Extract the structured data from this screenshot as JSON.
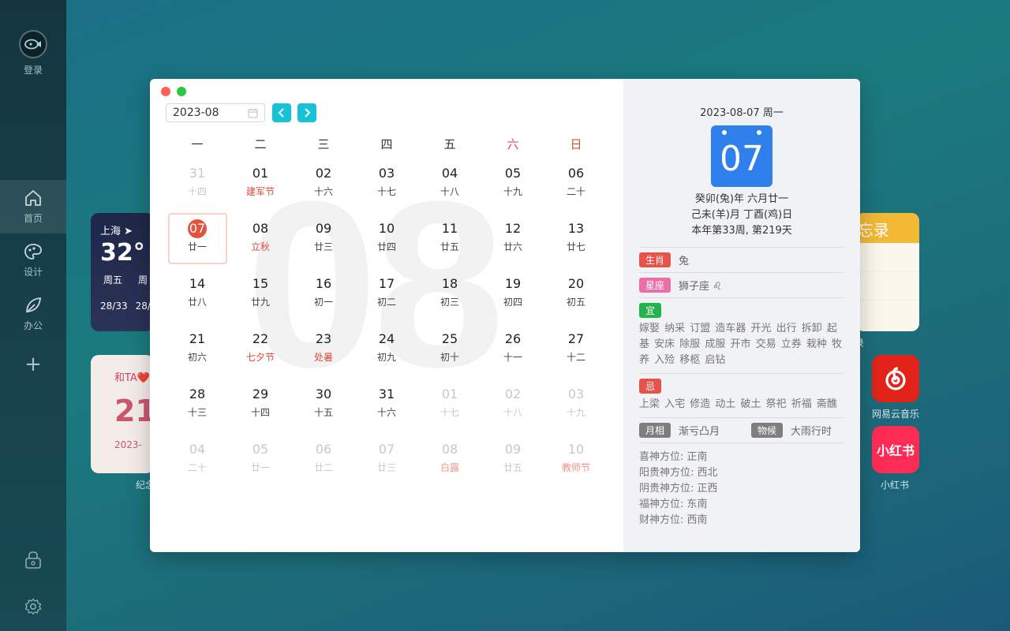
{
  "sidebar": {
    "login_label": "登录",
    "items": [
      {
        "label": "首页",
        "icon": "home-icon",
        "active": true
      },
      {
        "label": "设计",
        "icon": "palette-icon",
        "active": false
      },
      {
        "label": "办公",
        "icon": "leaf-icon",
        "active": false
      }
    ],
    "add_icon": "+"
  },
  "widgets": {
    "weather": {
      "city": "上海",
      "temp": "32°",
      "days": [
        "周五",
        "周"
      ],
      "temps": [
        "28/33",
        "28/"
      ]
    },
    "love": {
      "title": "和TA❤️",
      "number": "21",
      "date": "2023-",
      "label": "纪念"
    },
    "memo": {
      "title": "忘录",
      "label": "录"
    },
    "apps": [
      {
        "label": "网易云音乐",
        "color": "#e2231a"
      },
      {
        "label": "小红书",
        "glyph": "小红书",
        "color": "#fe2c55"
      }
    ]
  },
  "calendar": {
    "month_value": "2023-08",
    "big_month": "08",
    "weekdays": [
      "一",
      "二",
      "三",
      "四",
      "五",
      "六",
      "日"
    ],
    "weeks": [
      [
        {
          "d": "31",
          "l": "十四",
          "other": true
        },
        {
          "d": "01",
          "l": "建军节",
          "fest": true
        },
        {
          "d": "02",
          "l": "十六"
        },
        {
          "d": "03",
          "l": "十七"
        },
        {
          "d": "04",
          "l": "十八"
        },
        {
          "d": "05",
          "l": "十九"
        },
        {
          "d": "06",
          "l": "二十"
        }
      ],
      [
        {
          "d": "07",
          "l": "廿一",
          "sel": true
        },
        {
          "d": "08",
          "l": "立秋",
          "fest": true
        },
        {
          "d": "09",
          "l": "廿三"
        },
        {
          "d": "10",
          "l": "廿四"
        },
        {
          "d": "11",
          "l": "廿五"
        },
        {
          "d": "12",
          "l": "廿六"
        },
        {
          "d": "13",
          "l": "廿七"
        }
      ],
      [
        {
          "d": "14",
          "l": "廿八"
        },
        {
          "d": "15",
          "l": "廿九"
        },
        {
          "d": "16",
          "l": "初一"
        },
        {
          "d": "17",
          "l": "初二"
        },
        {
          "d": "18",
          "l": "初三"
        },
        {
          "d": "19",
          "l": "初四"
        },
        {
          "d": "20",
          "l": "初五"
        }
      ],
      [
        {
          "d": "21",
          "l": "初六"
        },
        {
          "d": "22",
          "l": "七夕节",
          "fest": true
        },
        {
          "d": "23",
          "l": "处暑",
          "fest": true
        },
        {
          "d": "24",
          "l": "初九"
        },
        {
          "d": "25",
          "l": "初十"
        },
        {
          "d": "26",
          "l": "十一"
        },
        {
          "d": "27",
          "l": "十二"
        }
      ],
      [
        {
          "d": "28",
          "l": "十三"
        },
        {
          "d": "29",
          "l": "十四"
        },
        {
          "d": "30",
          "l": "十五"
        },
        {
          "d": "31",
          "l": "十六"
        },
        {
          "d": "01",
          "l": "十七",
          "other": true
        },
        {
          "d": "02",
          "l": "十八",
          "other": true
        },
        {
          "d": "03",
          "l": "十九",
          "other": true
        }
      ],
      [
        {
          "d": "04",
          "l": "二十",
          "other": true
        },
        {
          "d": "05",
          "l": "廿一",
          "other": true
        },
        {
          "d": "06",
          "l": "廿二",
          "other": true
        },
        {
          "d": "07",
          "l": "廿三",
          "other": true
        },
        {
          "d": "08",
          "l": "白露",
          "other": true,
          "fest": true
        },
        {
          "d": "09",
          "l": "廿五",
          "other": true
        },
        {
          "d": "10",
          "l": "教师节",
          "other": true,
          "fest": true
        }
      ]
    ]
  },
  "detail": {
    "date_header": "2023-08-07 周一",
    "day": "07",
    "lunar_lines": [
      "癸卯(兔)年 六月廿一",
      "己未(羊)月 丁酉(鸡)日",
      "本年第33周, 第219天"
    ],
    "zodiac_tag": "生肖",
    "zodiac_value": "兔",
    "star_tag": "星座",
    "star_value": "狮子座 ♌",
    "yi_tag": "宜",
    "yi_text": "嫁娶 纳采 订盟 造车器 开光 出行 拆卸 起基 安床 除服 成服 开市 交易 立券 栽种 牧养 入殓 移柩 启钻",
    "ji_tag": "忌",
    "ji_text": "上梁 入宅 修造 动土 破土 祭祀 祈福 斋醮",
    "moon_tag": "月相",
    "moon_value": "渐亏凸月",
    "wuhou_tag": "物候",
    "wuhou_value": "大雨行时",
    "directions": [
      "喜神方位: 正南",
      "阳贵神方位: 西北",
      "阴贵神方位: 正西",
      "福神方位: 东南",
      "财神方位: 西南"
    ]
  },
  "colors": {
    "accent": "#17c1d8",
    "selected": "#e5533f",
    "festival": "#e04a3f",
    "day_tile": "#2f80ed"
  }
}
